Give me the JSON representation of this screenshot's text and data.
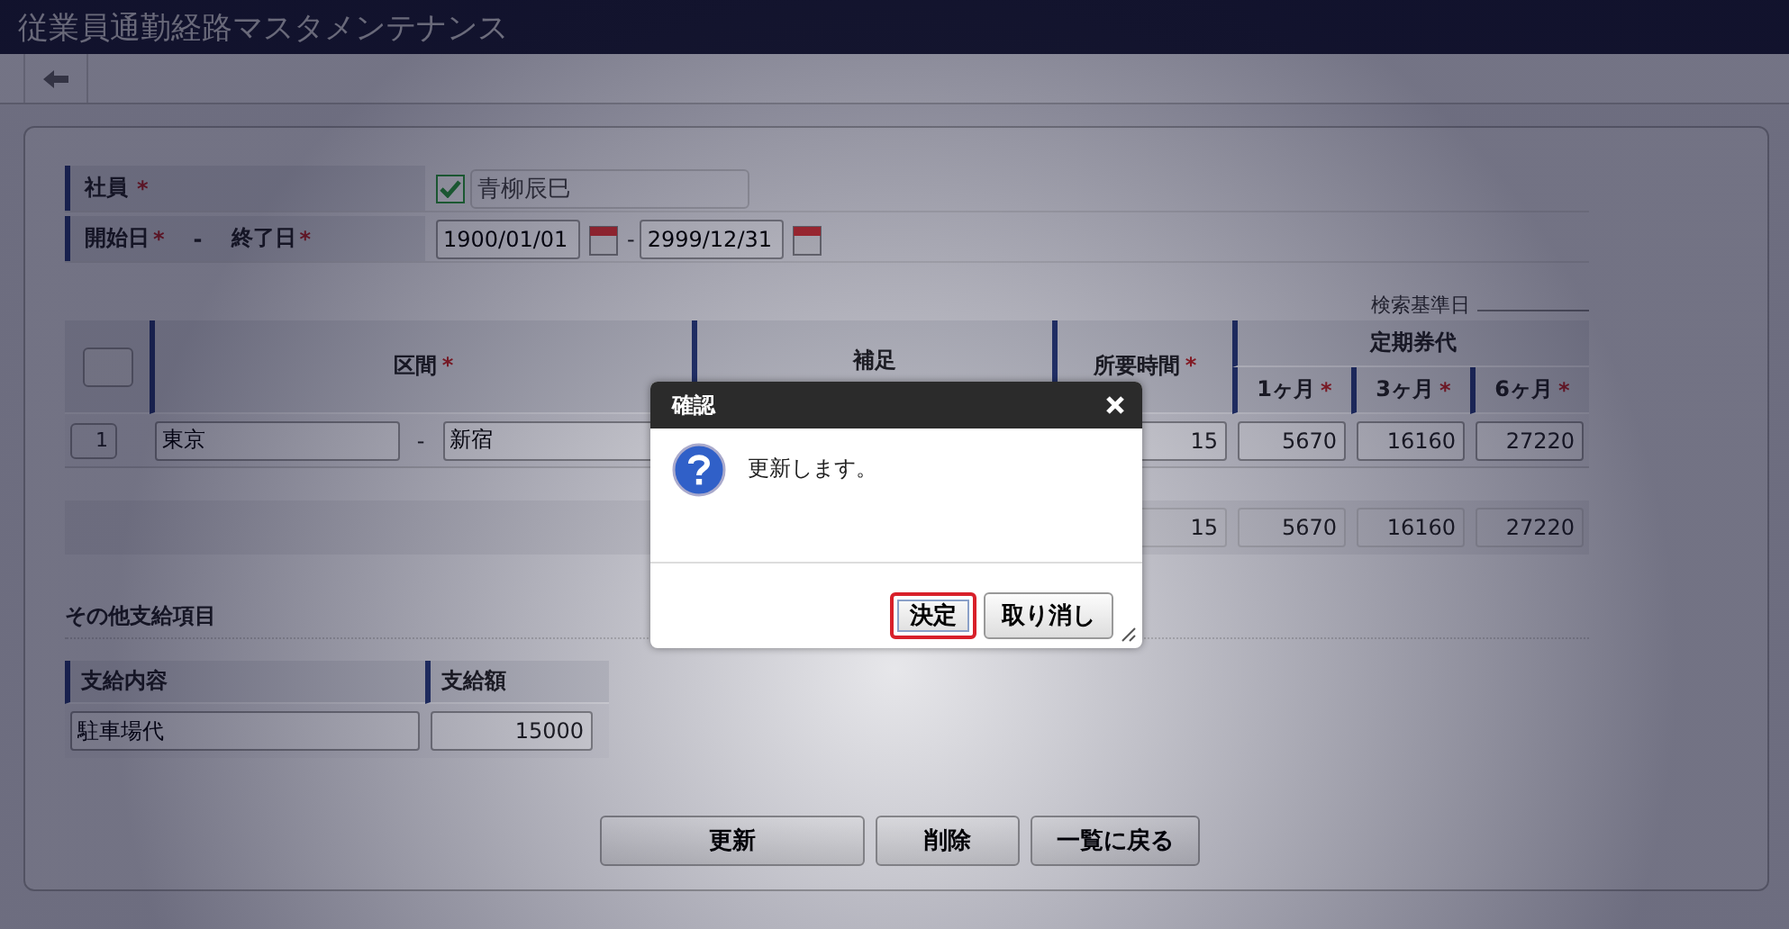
{
  "window": {
    "title": "従業員通勤経路マスタメンテナンス"
  },
  "form": {
    "employee_label": {
      "text": "社員",
      "mark": "*"
    },
    "employee": {
      "checked": true,
      "name": "青柳辰巳"
    },
    "period_labels": [
      {
        "text": "開始日",
        "mark": "*"
      },
      {
        "text": "-"
      },
      {
        "text": "終了日",
        "mark": "*"
      }
    ],
    "start_date": "1900/01/01",
    "date_separator": "-",
    "end_date": "2999/12/31"
  },
  "search_base_date": {
    "label": "検索基準日"
  },
  "routes": {
    "select_all": {
      "checked": false
    },
    "columns": [
      {
        "text": "区間",
        "mark": "*"
      },
      {
        "text": "補足"
      },
      {
        "text": "所要時間",
        "mark": "*"
      }
    ],
    "group": {
      "text": "定期券代",
      "columns": [
        {
          "text": "1ヶ月",
          "mark": "*"
        },
        {
          "text": "3ヶ月",
          "mark": "*"
        },
        {
          "text": "6ヶ月",
          "mark": "*"
        }
      ]
    },
    "rows": [
      {
        "no": "1",
        "from": "東京",
        "separator": "-",
        "to": "新宿",
        "time": "15",
        "m1": "5670",
        "m3": "16160",
        "m6": "27220"
      }
    ],
    "total": {
      "time": "15",
      "m1": "5670",
      "m3": "16160",
      "m6": "27220"
    }
  },
  "other": {
    "title": "その他支給項目",
    "columns": [
      "支給内容",
      "支給額"
    ],
    "rows": [
      {
        "content": "駐車場代",
        "amount": "15000"
      }
    ]
  },
  "buttons": [
    "更新",
    "削除",
    "一覧に戻る"
  ],
  "dialog": {
    "title": "確認",
    "message": "更新します。",
    "buttons": [
      {
        "label": "決定",
        "focused": true
      },
      {
        "label": "取り消し",
        "focused": false
      }
    ]
  }
}
